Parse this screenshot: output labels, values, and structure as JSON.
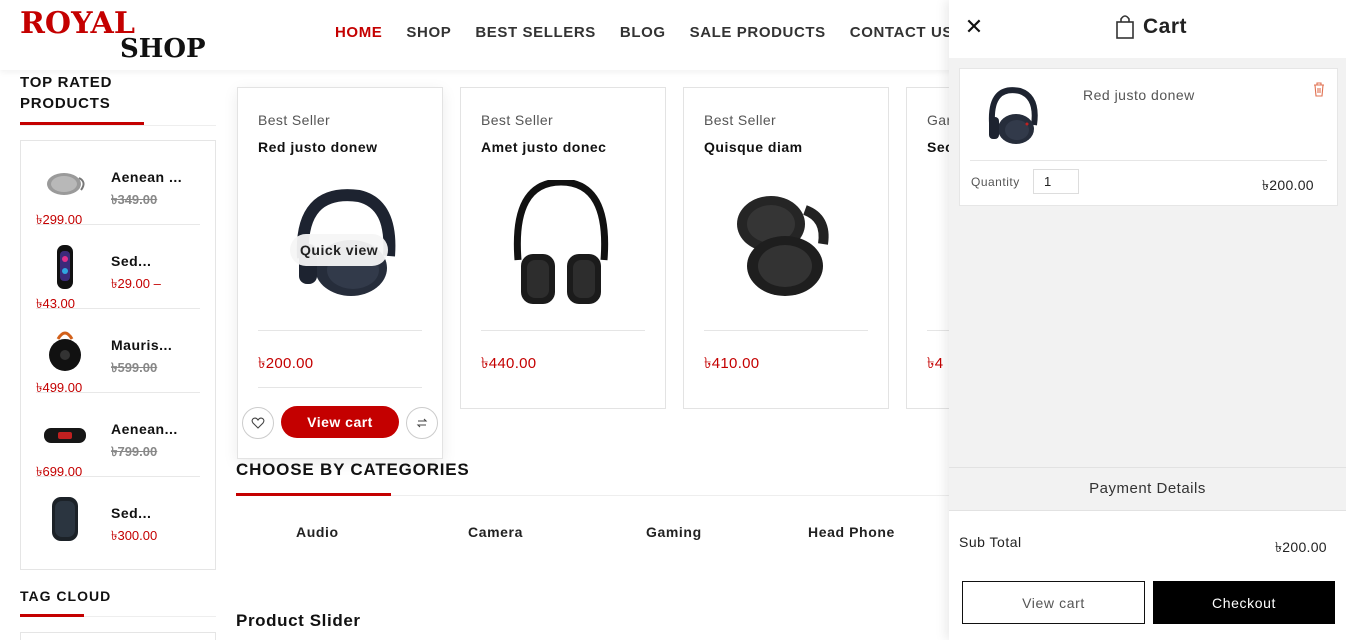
{
  "brand": {
    "line1": "ROYAL",
    "line2": "SHOP",
    "color": "#c40000"
  },
  "nav": {
    "items": [
      "HOME",
      "SHOP",
      "BEST SELLERS",
      "BLOG",
      "SALE PRODUCTS",
      "CONTACT US"
    ],
    "active": "HOME"
  },
  "sidebar": {
    "top_rated_title": "TOP RATED PRODUCTS",
    "top_rated_title_line1": "TOP RATED",
    "top_rated_title_line2": "PRODUCTS",
    "products": [
      {
        "name": "Aenean ...",
        "old_price": "৳349.00",
        "price": "৳299.00",
        "icon": "speaker-grey-icon"
      },
      {
        "name": "Sed...",
        "price_from": "৳29.00 –",
        "price_to": "৳43.00",
        "icon": "speaker-tall-icon"
      },
      {
        "name": "Mauris...",
        "old_price": "৳599.00",
        "price": "৳499.00",
        "icon": "speaker-round-icon"
      },
      {
        "name": "Aenean...",
        "old_price": "৳799.00",
        "price": "৳699.00",
        "icon": "speaker-bar-icon"
      },
      {
        "name": "Sed...",
        "price": "৳300.00",
        "icon": "smart-speaker-icon"
      }
    ],
    "tag_cloud_title": "TAG CLOUD"
  },
  "products": [
    {
      "tag": "Best Seller",
      "title": "Red justo donew",
      "price": "৳200.00",
      "quick_view": "Quick view",
      "cart_button": "View cart",
      "icon": "headphones-icon"
    },
    {
      "tag": "Best Seller",
      "title": "Amet justo donec",
      "price": "৳440.00",
      "icon": "headphones-icon"
    },
    {
      "tag": "Best Seller",
      "title": "Quisque diam",
      "price": "৳410.00",
      "icon": "headphones-icon"
    },
    {
      "tag": "Gar",
      "title": "Sec",
      "price": "৳4",
      "icon": "headphones-icon"
    }
  ],
  "categories": {
    "title": "CHOOSE BY CATEGORIES",
    "items": [
      "Audio",
      "Camera",
      "Gaming",
      "Head Phone"
    ]
  },
  "slider_title": "Product Slider",
  "cart": {
    "title": "Cart",
    "item": {
      "name": "Red justo donew",
      "quantity_label": "Quantity",
      "quantity": "1",
      "price": "৳200.00"
    },
    "payment_details": "Payment Details",
    "subtotal_label": "Sub Total",
    "subtotal_value": "৳200.00",
    "view_cart": "View cart",
    "checkout": "Checkout"
  }
}
